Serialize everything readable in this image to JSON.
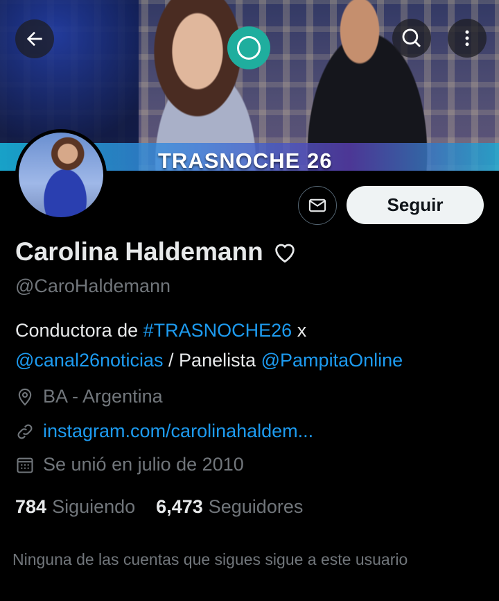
{
  "banner": {
    "title": "TRASNOCHE 26"
  },
  "header": {
    "back_icon": "arrow-left-icon",
    "search_icon": "search-icon",
    "more_icon": "more-vertical-icon"
  },
  "profile": {
    "name": "Carolina Haldemann",
    "name_emoji": "heart-outline-icon",
    "handle": "@CaroHaldemann",
    "bio": {
      "part1": "Conductora de ",
      "hashtag": "#TRASNOCHE26",
      "part2": " x",
      "mention1": "@canal26noticias",
      "part3": " / Panelista ",
      "mention2": "@PampitaOnline"
    },
    "location": "BA - Argentina",
    "website": "instagram.com/carolinahaldem...",
    "joined": "Se unió en julio de 2010"
  },
  "actions": {
    "message_icon": "mail-icon",
    "follow_label": "Seguir"
  },
  "stats": {
    "following_count": "784",
    "following_label": "Siguiendo",
    "followers_count": "6,473",
    "followers_label": "Seguidores"
  },
  "notice": "Ninguna de las cuentas que sigues sigue a este usuario",
  "colors": {
    "background": "#000000",
    "link": "#1d9bf0",
    "secondary_text": "#71767b",
    "primary_text": "#e7e9ea"
  }
}
